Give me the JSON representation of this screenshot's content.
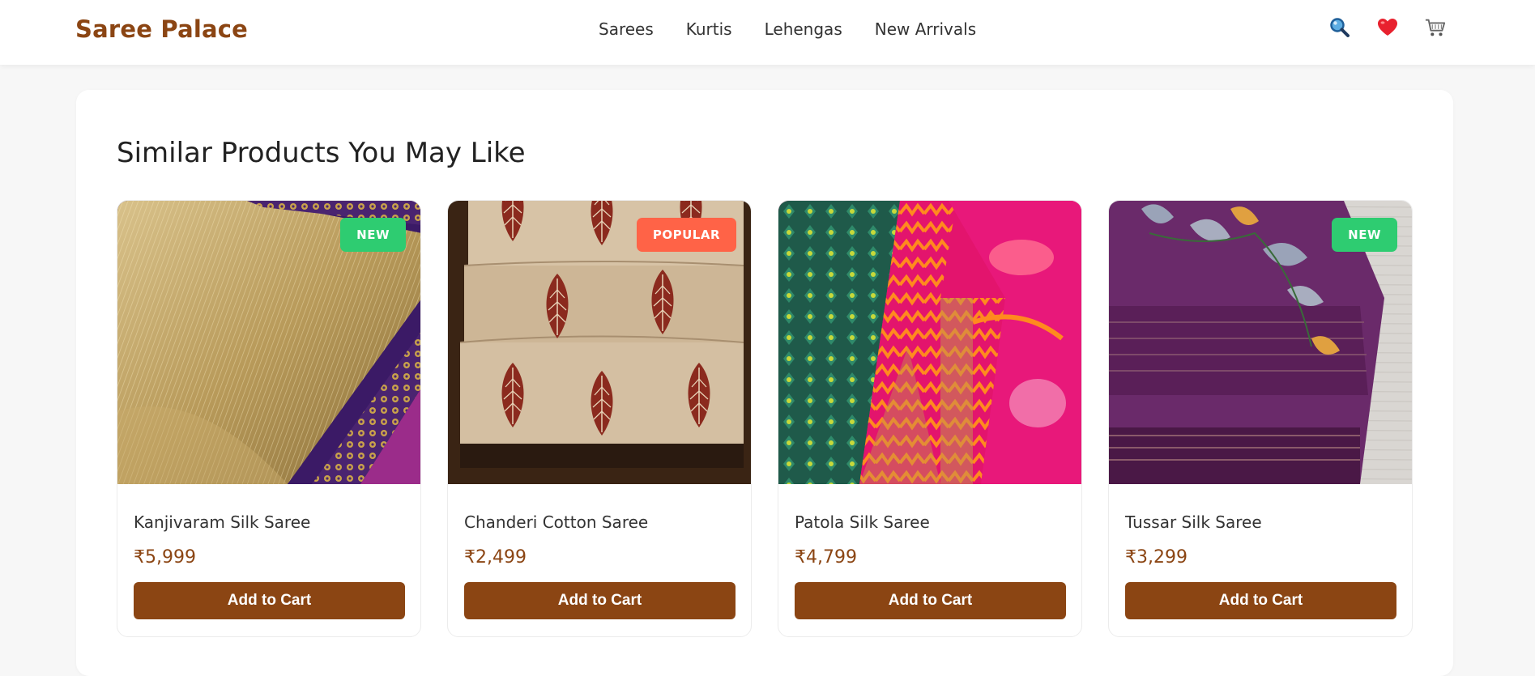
{
  "brand": {
    "name": "Saree Palace"
  },
  "nav": {
    "items": [
      {
        "label": "Sarees"
      },
      {
        "label": "Kurtis"
      },
      {
        "label": "Lehengas"
      },
      {
        "label": "New Arrivals"
      }
    ]
  },
  "header_icons": [
    {
      "name": "search-icon"
    },
    {
      "name": "heart-icon"
    },
    {
      "name": "cart-icon"
    }
  ],
  "section": {
    "title": "Similar Products You May Like"
  },
  "products": [
    {
      "name": "Kanjivaram Silk Saree",
      "price": "₹5,999",
      "badge": "NEW",
      "button": "Add to Cart"
    },
    {
      "name": "Chanderi Cotton Saree",
      "price": "₹2,499",
      "badge": "POPULAR",
      "button": "Add to Cart"
    },
    {
      "name": "Patola Silk Saree",
      "price": "₹4,799",
      "badge": "",
      "button": "Add to Cart"
    },
    {
      "name": "Tussar Silk Saree",
      "price": "₹3,299",
      "badge": "NEW",
      "button": "Add to Cart"
    }
  ],
  "colors": {
    "brand": "#8b4513",
    "badge_new": "#2ecc71",
    "badge_popular": "#ff6347"
  }
}
